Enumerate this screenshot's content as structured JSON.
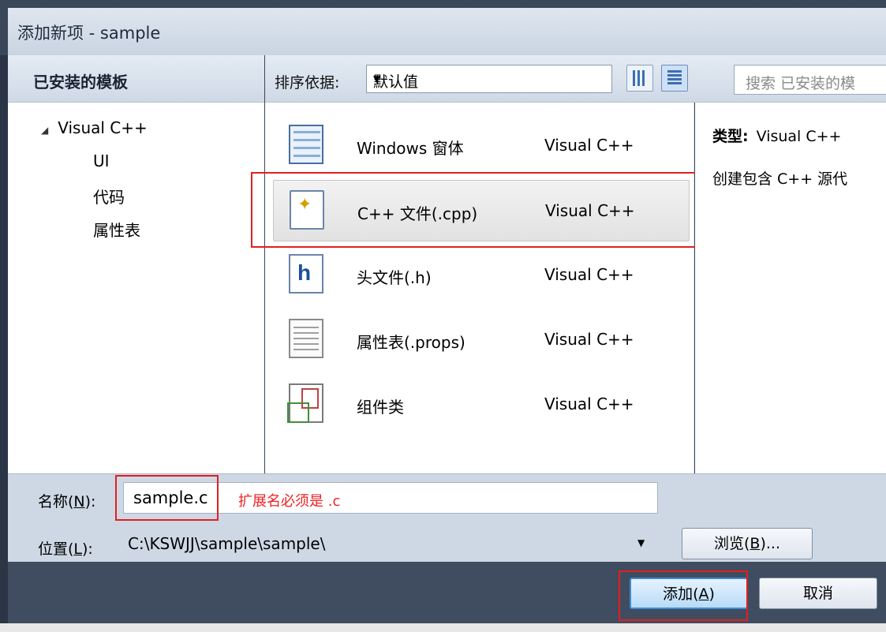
{
  "window": {
    "title": "添加新项 - sample"
  },
  "sidebar": {
    "header": "已安装的模板",
    "tree": {
      "root": "Visual C++",
      "children": [
        "UI",
        "代码",
        "属性表"
      ]
    }
  },
  "toolbar": {
    "sort_label": "排序依据:",
    "sort_value": "默认值",
    "search_placeholder": "搜索 已安装的模"
  },
  "templates": [
    {
      "name": "Windows 窗体",
      "lang": "Visual C++",
      "icon": "windows-form-icon"
    },
    {
      "name": "C++ 文件(.cpp)",
      "lang": "Visual C++",
      "icon": "cpp-file-icon",
      "selected": true
    },
    {
      "name": "头文件(.h)",
      "lang": "Visual C++",
      "icon": "header-file-icon"
    },
    {
      "name": "属性表(.props)",
      "lang": "Visual C++",
      "icon": "property-sheet-icon"
    },
    {
      "name": "组件类",
      "lang": "Visual C++",
      "icon": "component-class-icon"
    }
  ],
  "details": {
    "type_label": "类型:",
    "type_value": "Visual C++",
    "description": "创建包含 C++ 源代"
  },
  "form": {
    "name_label": "名称(",
    "name_key": "N",
    "name_label_end": "):",
    "name_value": "sample.c",
    "name_hint": "扩展名必须是 .c",
    "location_label": "位置(",
    "location_key": "L",
    "location_label_end": "):",
    "location_value": "C:\\KSWJJ\\sample\\sample\\",
    "browse_label": "浏览(",
    "browse_key": "B",
    "browse_label_end": ")..."
  },
  "buttons": {
    "add_label": "添加(",
    "add_key": "A",
    "add_label_end": ")",
    "cancel_label": "取消"
  },
  "colors": {
    "highlight": "#e02020",
    "hint": "#e22222"
  }
}
